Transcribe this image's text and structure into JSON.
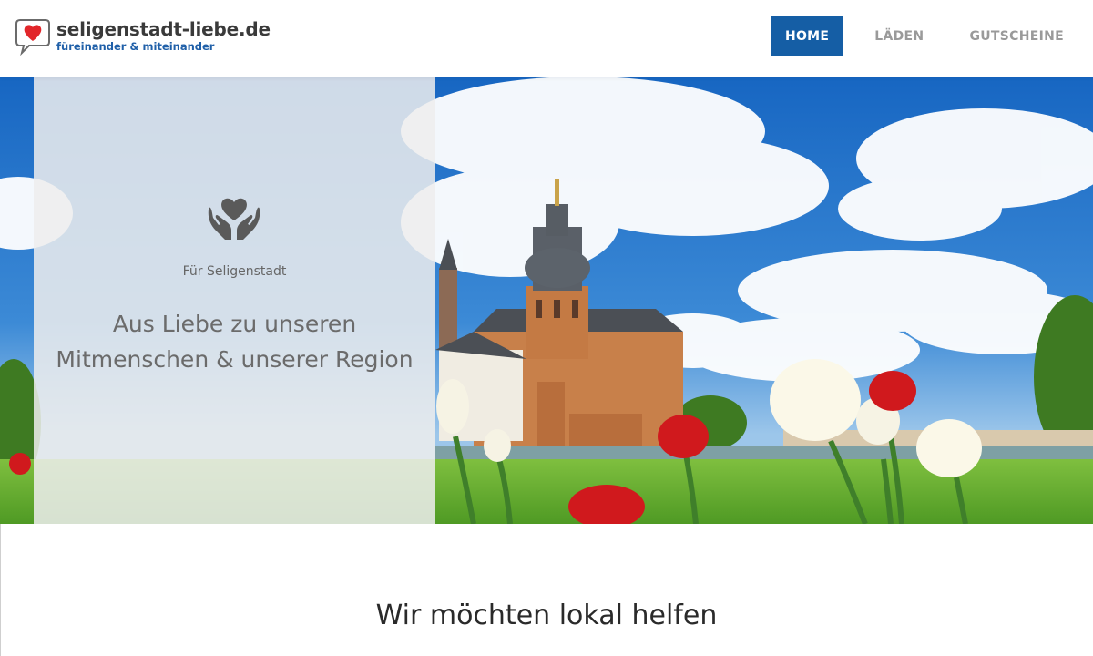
{
  "site": {
    "title": "seligenstadt-liebe.de",
    "tagline": "füreinander & miteinander"
  },
  "nav": {
    "items": [
      {
        "label": "HOME",
        "active": true
      },
      {
        "label": "LÄDEN",
        "active": false
      },
      {
        "label": "GUTSCHEINE",
        "active": false
      }
    ]
  },
  "hero": {
    "icon": "hands-heart-icon",
    "kicker": "Für Seligenstadt",
    "headline": "Aus Liebe zu unseren Mitmenschen & unserer Region"
  },
  "section": {
    "title": "Wir möchten lokal helfen"
  },
  "colors": {
    "brand_blue": "#155ea5",
    "heart_red": "#e2262a",
    "nav_inactive": "#9a9a9a"
  }
}
